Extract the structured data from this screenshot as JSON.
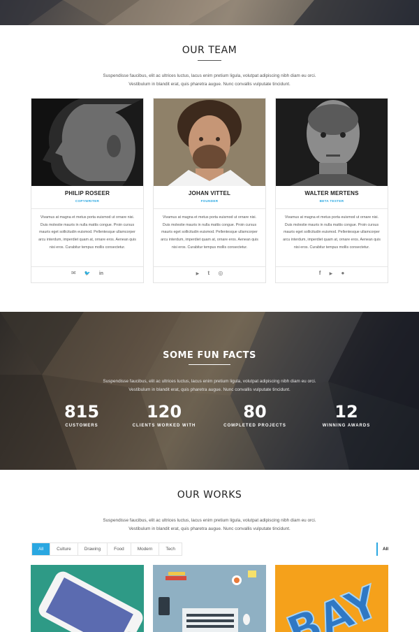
{
  "team": {
    "title": "OUR TEAM",
    "intro_line1": "Suspendisse faucibus, elit ac ultrices luctus, lacus enim pretium ligula, volutpat adipiscing nibh diam eu orci.",
    "intro_line2": "Vestibulum in blandit erat, quis pharetra augue. Nunc convallis vulputate tincidunt.",
    "members": [
      {
        "name": "PHILIP ROSEER",
        "role": "COPYWRITER",
        "bio": "Vivamus at magna et metus porta euismod ut ornare nisi. Duis molestie mauris in nulla mattis congue. Proin cursus mauris eget sollicitudin euismod. Pellentesque ullamcorper arcu interdum, imperdiet quam at, ornare eros. Aenean quis nisi eros. Curabitur tempus mollis consectetur.",
        "socials": [
          "envelope-icon",
          "twitter-icon",
          "linkedin-icon"
        ]
      },
      {
        "name": "JOHAN VITTEL",
        "role": "FOUNDER",
        "bio": "Vivamus at magna et metus porta euismod ut ornare nisi. Duis molestie mauris in nulla mattis congue. Proin cursus mauris eget sollicitudin euismod. Pellentesque ullamcorper arcu interdum, imperdiet quam at, ornare eros. Aenean quis nisi eros. Curabitur tempus mollis consectetur.",
        "socials": [
          "youtube-icon",
          "tumblr-icon",
          "dribbble-icon"
        ]
      },
      {
        "name": "WALTER MERTENS",
        "role": "BETA TESTER",
        "bio": "Vivamus at magna et metus porta euismod ut ornare nisi. Duis molestie mauris in nulla mattis congue. Proin cursus mauris eget sollicitudin euismod. Pellentesque ullamcorper arcu interdum, imperdiet quam at, ornare eros. Aenean quis nisi eros. Curabitur tempus mollis consectetur.",
        "socials": [
          "facebook-icon",
          "youtube-icon",
          "apple-icon"
        ]
      }
    ]
  },
  "facts": {
    "title": "SOME FUN FACTS",
    "intro_line1": "Suspendisse faucibus, elit ac ultrices luctus, lacus enim pretium ligula, volutpat adipiscing nibh diam eu orci.",
    "intro_line2": "Vestibulum in blandit erat, quis pharetra augue. Nunc convallis vulputate tincidunt.",
    "stats": [
      {
        "number": "815",
        "label": "CUSTOMERS"
      },
      {
        "number": "120",
        "label": "CLIENTS WORKED WITH"
      },
      {
        "number": "80",
        "label": "COMPLETED PROJECTS"
      },
      {
        "number": "12",
        "label": "WINNING AWARDS"
      }
    ]
  },
  "works": {
    "title": "OUR WORKS",
    "intro_line1": "Suspendisse faucibus, elit ac ultrices luctus, lacus enim pretium ligula, volutpat adipiscing nibh diam eu orci.",
    "intro_line2": "Vestibulum in blandit erat, quis pharetra augue. Nunc convallis vulputate tincidunt.",
    "filters": [
      "All",
      "Culture",
      "Drawing",
      "Food",
      "Modern",
      "Tech"
    ],
    "active_filter": "All",
    "filter_dropdown_value": "All",
    "thumb_text": "BAY"
  },
  "colors": {
    "accent": "#2aa7e1",
    "work1_bg": "#2e9a86",
    "work2_bg": "#8fb0c3",
    "work3_bg": "#f5a11b"
  },
  "icons": {
    "envelope-icon": "✉",
    "twitter-icon": "🐦",
    "linkedin-icon": "in",
    "youtube-icon": "▶",
    "tumblr-icon": "t",
    "dribbble-icon": "◎",
    "facebook-icon": "f",
    "apple-icon": ""
  }
}
